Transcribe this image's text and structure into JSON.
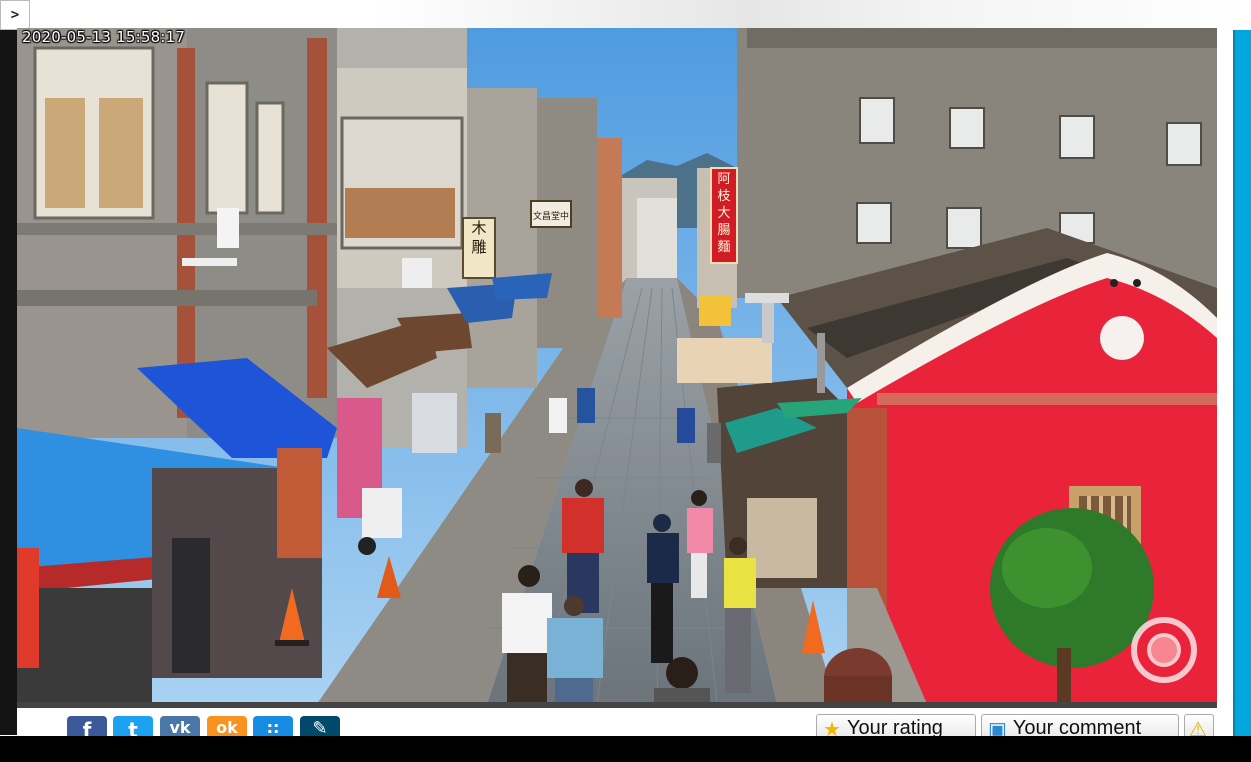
{
  "top": {
    "expand_label": ">"
  },
  "camera": {
    "timestamp": "2020-05-13 15:58:17",
    "signs": {
      "sign_1": "木雕",
      "sign_2": "文昌堂中",
      "sign_3": "阿枝大腸麵"
    }
  },
  "share": {
    "buttons": [
      {
        "icon": "facebook-icon",
        "glyph": "f",
        "color": "#3b5998"
      },
      {
        "icon": "twitter-icon",
        "glyph": "t",
        "color": "#1da1f2"
      },
      {
        "icon": "vk-icon",
        "glyph": "vk",
        "color": "#4a76a8"
      },
      {
        "icon": "odnoklassniki-icon",
        "glyph": "ok",
        "color": "#f7931e"
      },
      {
        "icon": "moimir-icon",
        "glyph": "::",
        "color": "#168de2"
      },
      {
        "icon": "livejournal-icon",
        "glyph": "✎",
        "color": "#00496b"
      }
    ]
  },
  "actions": {
    "rating_label": "Your rating",
    "comment_label": "Your comment",
    "rating_icon": "star-icon",
    "comment_icon": "speech-bubble-icon",
    "report_icon": "warning-icon"
  }
}
